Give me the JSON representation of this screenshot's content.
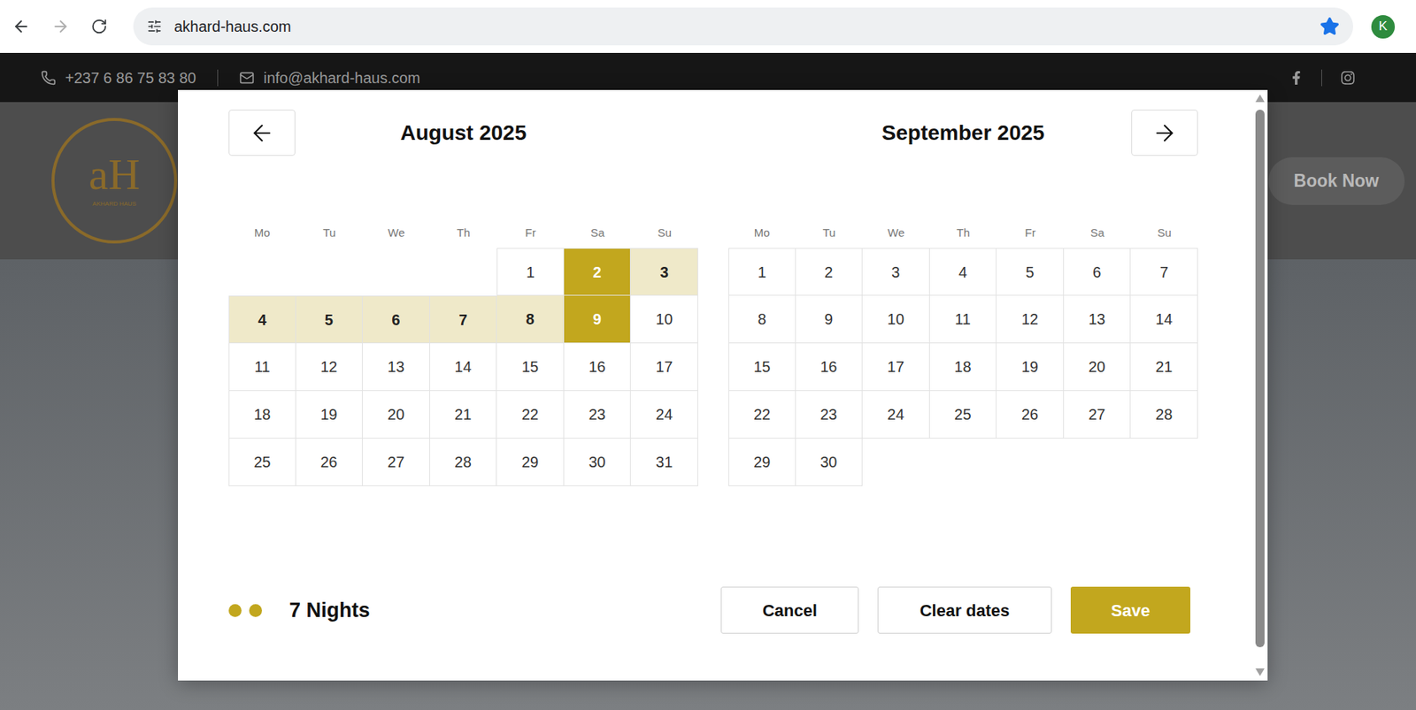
{
  "browser": {
    "url": "akhard-haus.com",
    "bookmarked": true,
    "profile_initial": "K",
    "back_enabled": true,
    "forward_enabled": false
  },
  "contact": {
    "phone": "+237 6 86 75 83 80",
    "email": "info@akhard-haus.com"
  },
  "header": {
    "logo": {
      "letters": "aH",
      "caption": "AKHARD HAUS"
    },
    "book_button": "Book Now"
  },
  "date_picker": {
    "months": [
      {
        "title": "August 2025",
        "offset": 4,
        "weekdays": [
          "Mo",
          "Tu",
          "We",
          "Th",
          "Fr",
          "Sa",
          "Su"
        ],
        "days": [
          {
            "label": "1",
            "selected": false,
            "in_range": false
          },
          {
            "label": "2",
            "selected": true,
            "in_range": false
          },
          {
            "label": "3",
            "selected": false,
            "in_range": true
          },
          {
            "label": "4",
            "selected": false,
            "in_range": true
          },
          {
            "label": "5",
            "selected": false,
            "in_range": true
          },
          {
            "label": "6",
            "selected": false,
            "in_range": true
          },
          {
            "label": "7",
            "selected": false,
            "in_range": true
          },
          {
            "label": "8",
            "selected": false,
            "in_range": true
          },
          {
            "label": "9",
            "selected": true,
            "in_range": false
          },
          {
            "label": "10",
            "selected": false,
            "in_range": false
          },
          {
            "label": "11",
            "selected": false,
            "in_range": false
          },
          {
            "label": "12",
            "selected": false,
            "in_range": false
          },
          {
            "label": "13",
            "selected": false,
            "in_range": false
          },
          {
            "label": "14",
            "selected": false,
            "in_range": false
          },
          {
            "label": "15",
            "selected": false,
            "in_range": false
          },
          {
            "label": "16",
            "selected": false,
            "in_range": false
          },
          {
            "label": "17",
            "selected": false,
            "in_range": false
          },
          {
            "label": "18",
            "selected": false,
            "in_range": false
          },
          {
            "label": "19",
            "selected": false,
            "in_range": false
          },
          {
            "label": "20",
            "selected": false,
            "in_range": false
          },
          {
            "label": "21",
            "selected": false,
            "in_range": false
          },
          {
            "label": "22",
            "selected": false,
            "in_range": false
          },
          {
            "label": "23",
            "selected": false,
            "in_range": false
          },
          {
            "label": "24",
            "selected": false,
            "in_range": false
          },
          {
            "label": "25",
            "selected": false,
            "in_range": false
          },
          {
            "label": "26",
            "selected": false,
            "in_range": false
          },
          {
            "label": "27",
            "selected": false,
            "in_range": false
          },
          {
            "label": "28",
            "selected": false,
            "in_range": false
          },
          {
            "label": "29",
            "selected": false,
            "in_range": false
          },
          {
            "label": "30",
            "selected": false,
            "in_range": false
          },
          {
            "label": "31",
            "selected": false,
            "in_range": false
          }
        ]
      },
      {
        "title": "September 2025",
        "offset": 0,
        "weekdays": [
          "Mo",
          "Tu",
          "We",
          "Th",
          "Fr",
          "Sa",
          "Su"
        ],
        "days": [
          {
            "label": "1",
            "selected": false,
            "in_range": false
          },
          {
            "label": "2",
            "selected": false,
            "in_range": false
          },
          {
            "label": "3",
            "selected": false,
            "in_range": false
          },
          {
            "label": "4",
            "selected": false,
            "in_range": false
          },
          {
            "label": "5",
            "selected": false,
            "in_range": false
          },
          {
            "label": "6",
            "selected": false,
            "in_range": false
          },
          {
            "label": "7",
            "selected": false,
            "in_range": false
          },
          {
            "label": "8",
            "selected": false,
            "in_range": false
          },
          {
            "label": "9",
            "selected": false,
            "in_range": false
          },
          {
            "label": "10",
            "selected": false,
            "in_range": false
          },
          {
            "label": "11",
            "selected": false,
            "in_range": false
          },
          {
            "label": "12",
            "selected": false,
            "in_range": false
          },
          {
            "label": "13",
            "selected": false,
            "in_range": false
          },
          {
            "label": "14",
            "selected": false,
            "in_range": false
          },
          {
            "label": "15",
            "selected": false,
            "in_range": false
          },
          {
            "label": "16",
            "selected": false,
            "in_range": false
          },
          {
            "label": "17",
            "selected": false,
            "in_range": false
          },
          {
            "label": "18",
            "selected": false,
            "in_range": false
          },
          {
            "label": "19",
            "selected": false,
            "in_range": false
          },
          {
            "label": "20",
            "selected": false,
            "in_range": false
          },
          {
            "label": "21",
            "selected": false,
            "in_range": false
          },
          {
            "label": "22",
            "selected": false,
            "in_range": false
          },
          {
            "label": "23",
            "selected": false,
            "in_range": false
          },
          {
            "label": "24",
            "selected": false,
            "in_range": false
          },
          {
            "label": "25",
            "selected": false,
            "in_range": false
          },
          {
            "label": "26",
            "selected": false,
            "in_range": false
          },
          {
            "label": "27",
            "selected": false,
            "in_range": false
          },
          {
            "label": "28",
            "selected": false,
            "in_range": false
          },
          {
            "label": "29",
            "selected": false,
            "in_range": false
          },
          {
            "label": "30",
            "selected": false,
            "in_range": false
          }
        ]
      }
    ],
    "nights_label": "7 Nights",
    "buttons": [
      "Cancel",
      "Clear dates",
      "Save"
    ]
  }
}
